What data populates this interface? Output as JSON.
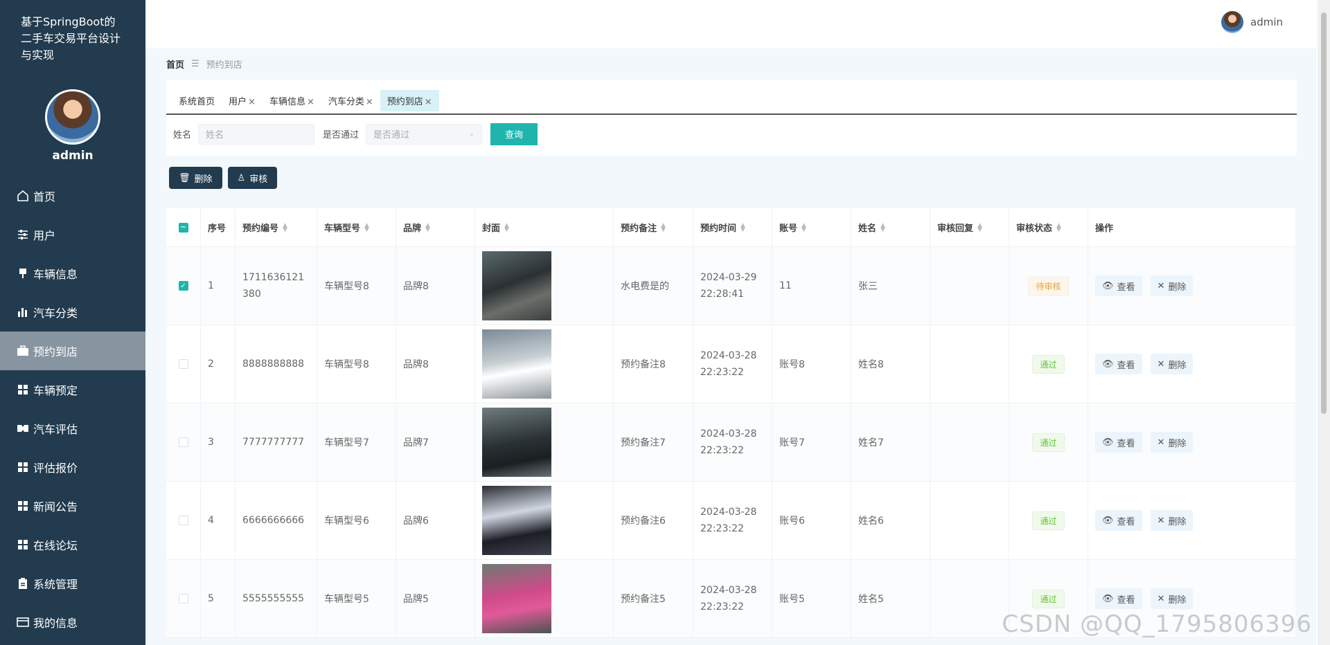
{
  "app": {
    "title": "基于SpringBoot的二手车交易平台设计与实现",
    "user": "admin"
  },
  "sidebar": {
    "username": "admin",
    "items": [
      {
        "label": "首页",
        "icon": "home-icon"
      },
      {
        "label": "用户",
        "icon": "sliders-icon"
      },
      {
        "label": "车辆信息",
        "icon": "pin-icon"
      },
      {
        "label": "汽车分类",
        "icon": "bar-chart-icon"
      },
      {
        "label": "预约到店",
        "icon": "briefcase-icon"
      },
      {
        "label": "车辆预定",
        "icon": "grid-icon"
      },
      {
        "label": "汽车评估",
        "icon": "gamepad-icon"
      },
      {
        "label": "评估报价",
        "icon": "grid-icon"
      },
      {
        "label": "新闻公告",
        "icon": "grid-icon"
      },
      {
        "label": "在线论坛",
        "icon": "grid-icon"
      },
      {
        "label": "系统管理",
        "icon": "clipboard-icon"
      },
      {
        "label": "我的信息",
        "icon": "card-icon"
      }
    ]
  },
  "breadcrumb": {
    "home": "首页",
    "current": "预约到店"
  },
  "tabs": [
    {
      "label": "系统首页",
      "closable": false
    },
    {
      "label": "用户",
      "closable": true
    },
    {
      "label": "车辆信息",
      "closable": true
    },
    {
      "label": "汽车分类",
      "closable": true
    },
    {
      "label": "预约到店",
      "closable": true
    }
  ],
  "search": {
    "name_label": "姓名",
    "name_placeholder": "姓名",
    "pass_label": "是否通过",
    "pass_placeholder": "是否通过",
    "query_button": "查询"
  },
  "actions": {
    "delete": "删除",
    "audit": "审核"
  },
  "table": {
    "headers": [
      "序号",
      "预约编号",
      "车辆型号",
      "品牌",
      "封面",
      "预约备注",
      "预约时间",
      "账号",
      "姓名",
      "审核回复",
      "审核状态",
      "操作"
    ],
    "view_label": "查看",
    "delete_label": "删除",
    "rows": [
      {
        "index": "1",
        "code": "1711636121380",
        "model": "车辆型号8",
        "brand": "品牌8",
        "remark": "水电费是的",
        "time": "2024-03-29 22:28:41",
        "account": "11",
        "name": "张三",
        "reply": "",
        "status": "待审核",
        "status_type": "pending",
        "checked": true
      },
      {
        "index": "2",
        "code": "8888888888",
        "model": "车辆型号8",
        "brand": "品牌8",
        "remark": "预约备注8",
        "time": "2024-03-28 22:23:22",
        "account": "账号8",
        "name": "姓名8",
        "reply": "",
        "status": "通过",
        "status_type": "pass",
        "checked": false
      },
      {
        "index": "3",
        "code": "7777777777",
        "model": "车辆型号7",
        "brand": "品牌7",
        "remark": "预约备注7",
        "time": "2024-03-28 22:23:22",
        "account": "账号7",
        "name": "姓名7",
        "reply": "",
        "status": "通过",
        "status_type": "pass",
        "checked": false
      },
      {
        "index": "4",
        "code": "6666666666",
        "model": "车辆型号6",
        "brand": "品牌6",
        "remark": "预约备注6",
        "time": "2024-03-28 22:23:22",
        "account": "账号6",
        "name": "姓名6",
        "reply": "",
        "status": "通过",
        "status_type": "pass",
        "checked": false
      },
      {
        "index": "5",
        "code": "5555555555",
        "model": "车辆型号5",
        "brand": "品牌5",
        "remark": "预约备注5",
        "time": "2024-03-28 22:23:22",
        "account": "账号5",
        "name": "姓名5",
        "reply": "",
        "status": "通过",
        "status_type": "pass",
        "checked": false
      }
    ]
  },
  "watermark": "CSDN @QQ_1795806396",
  "colors": {
    "sidebar": "#223b4e",
    "accent": "#1fb5ad",
    "active_menu": "#8795a1"
  }
}
